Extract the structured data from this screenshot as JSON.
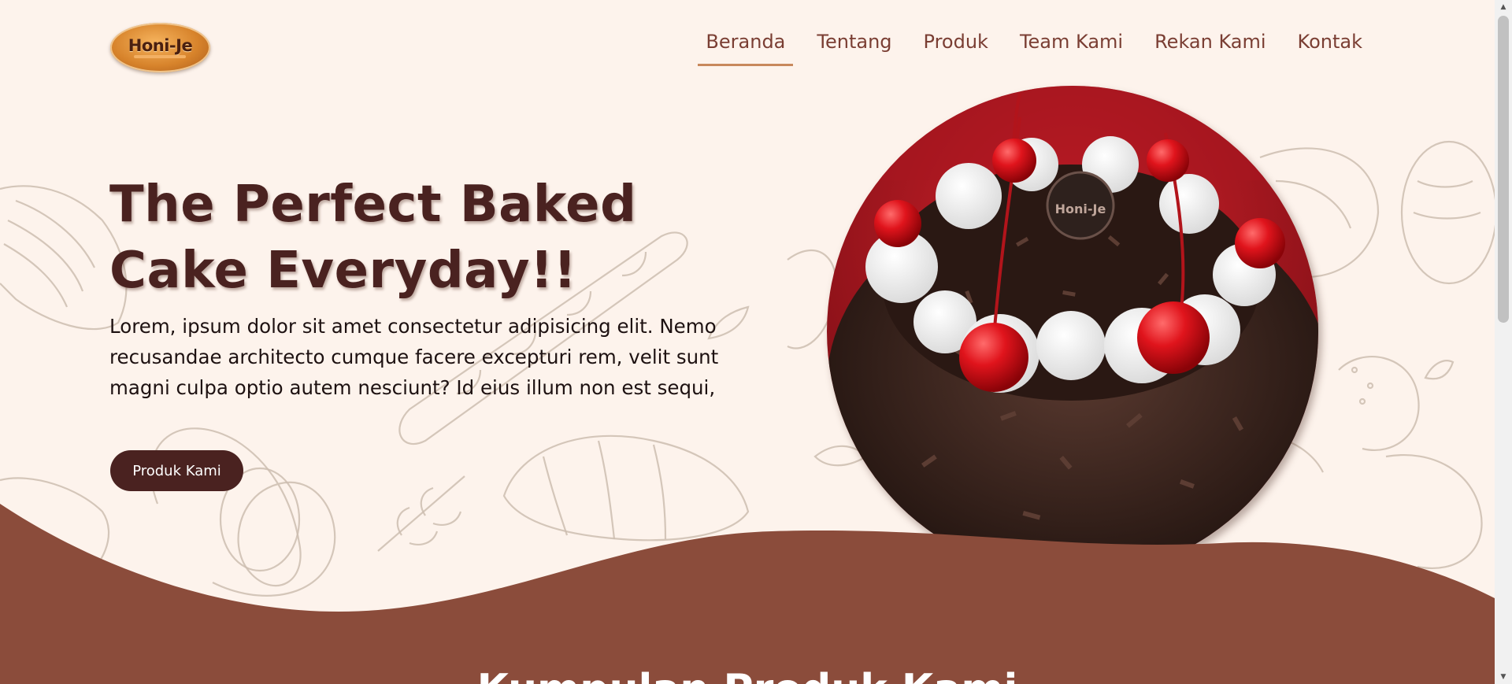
{
  "header": {
    "logo_text": "Honi-Je",
    "nav": [
      {
        "label": "Beranda",
        "active": true
      },
      {
        "label": "Tentang",
        "active": false
      },
      {
        "label": "Produk",
        "active": false
      },
      {
        "label": "Team Kami",
        "active": false
      },
      {
        "label": "Rekan Kami",
        "active": false
      },
      {
        "label": "Kontak",
        "active": false
      }
    ]
  },
  "hero": {
    "title_line1": "The Perfect Baked",
    "title_line2": "Cake Everyday!!",
    "description": "Lorem, ipsum dolor sit amet consectetur adipisicing elit. Nemo recusandae architecto cumque facere excepturi rem, velit sunt magni culpa optio autem nesciunt? Id eius illum non est sequi,",
    "cta_label": "Produk Kami",
    "image_badge_text": "Honi-Je"
  },
  "next_section": {
    "title": "Kumpulan Produk Kami"
  },
  "colors": {
    "background": "#fdf3ec",
    "primary_dark": "#4a2220",
    "wave_brown": "#8b4c3b",
    "nav_text": "#7a3e33",
    "nav_underline": "#c8885c"
  }
}
